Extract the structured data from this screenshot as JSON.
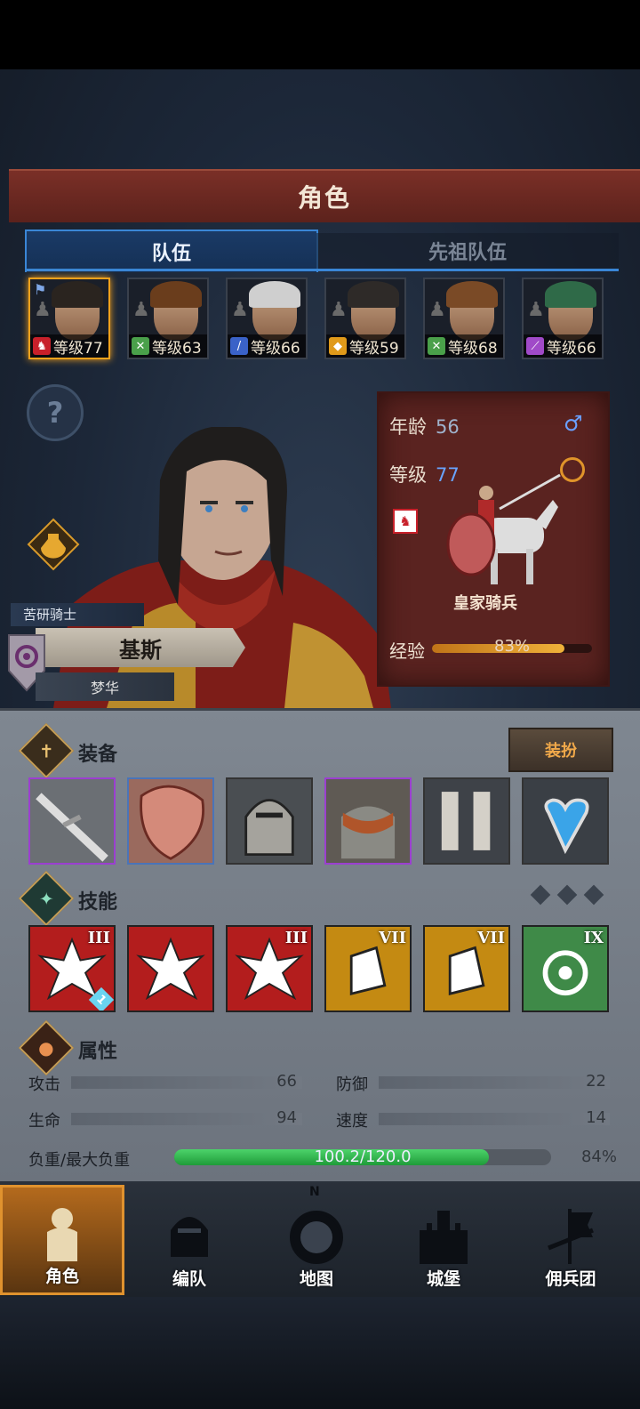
{
  "header": {
    "title": "角色"
  },
  "tabs": [
    {
      "label": "队伍",
      "active": true
    },
    {
      "label": "先祖队伍",
      "active": false
    }
  ],
  "roster": [
    {
      "level": "等级77",
      "class_icon": "horse-icon",
      "class_color": "#c8202a",
      "selected": true,
      "hair": "#2a241f"
    },
    {
      "level": "等级63",
      "class_icon": "bow-icon",
      "class_color": "#4aa04a",
      "selected": false,
      "hair": "#6a3d1c"
    },
    {
      "level": "等级66",
      "class_icon": "sword-icon",
      "class_color": "#3a62c8",
      "selected": false,
      "hair": "#cfcfcf"
    },
    {
      "level": "等级59",
      "class_icon": "shield-icon",
      "class_color": "#e09a1a",
      "selected": false,
      "hair": "#2e2a28"
    },
    {
      "level": "等级68",
      "class_icon": "bow-icon",
      "class_color": "#4aa04a",
      "selected": false,
      "hair": "#7a4a26"
    },
    {
      "level": "等级66",
      "class_icon": "staff-icon",
      "class_color": "#a04ac8",
      "selected": false,
      "hair": "#2f6a48"
    }
  ],
  "hero": {
    "title": "苦研骑士",
    "name": "基斯",
    "origin": "梦华"
  },
  "info": {
    "age_label": "年龄",
    "age": "56",
    "level_label": "等级",
    "level": "77",
    "unit": "皇家骑兵",
    "exp_label": "经验",
    "exp_pct_text": "83%",
    "exp_fraction": 0.83
  },
  "equipment": {
    "title": "装备",
    "dress_label": "装扮",
    "slots": [
      {
        "name": "lance-icon",
        "border": "#9b3fd0"
      },
      {
        "name": "shield-icon",
        "border": "#4a74b8"
      },
      {
        "name": "helmet-icon",
        "border": "#333333"
      },
      {
        "name": "armor-icon",
        "border": "#9b3fd0"
      },
      {
        "name": "boots-icon",
        "border": "#333333"
      },
      {
        "name": "amulet-icon",
        "border": "#333333"
      }
    ]
  },
  "skills": {
    "title": "技能",
    "items": [
      {
        "name": "lance-strike-icon",
        "color": "#b31d1d",
        "rank": "III",
        "badge": "1"
      },
      {
        "name": "burst-icon",
        "color": "#b31d1d",
        "rank": "",
        "badge": ""
      },
      {
        "name": "charge-icon",
        "color": "#b31d1d",
        "rank": "III",
        "badge": ""
      },
      {
        "name": "guard-icon",
        "color": "#c48a12",
        "rank": "VII",
        "badge": ""
      },
      {
        "name": "guard-icon",
        "color": "#c48a12",
        "rank": "VII",
        "badge": ""
      },
      {
        "name": "target-icon",
        "color": "#3f8a48",
        "rank": "IX",
        "badge": ""
      }
    ]
  },
  "attributes": {
    "title": "属性",
    "attack_label": "攻击",
    "attack": "66",
    "defense_label": "防御",
    "defense": "22",
    "hp_label": "生命",
    "hp": "94",
    "speed_label": "速度",
    "speed": "14",
    "load_label": "负重/最大负重",
    "load_text": "100.2/120.0",
    "load_fraction": 0.835,
    "load_pct": "84%"
  },
  "nav": [
    {
      "label": "角色",
      "icon": "knight-icon",
      "active": true
    },
    {
      "label": "编队",
      "icon": "helmet-icon",
      "active": false
    },
    {
      "label": "地图",
      "icon": "compass-map-icon",
      "active": false,
      "compass_n": "N"
    },
    {
      "label": "城堡",
      "icon": "castle-icon",
      "active": false
    },
    {
      "label": "佣兵团",
      "icon": "banner-icon",
      "active": false
    }
  ]
}
